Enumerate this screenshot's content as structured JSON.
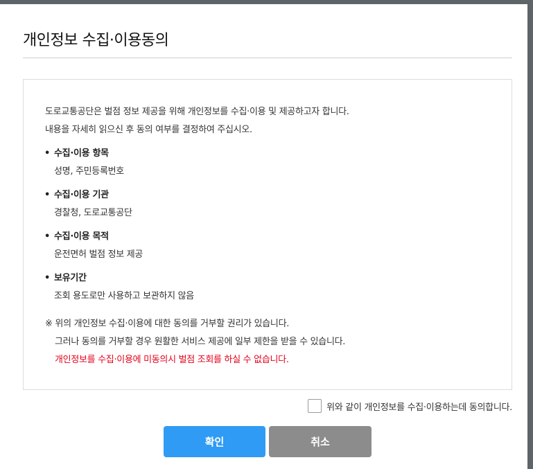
{
  "dialog": {
    "title": "개인정보 수집·이용동의",
    "intro_line1": "도로교통공단은 벌점 정보 제공을 위해 개인정보를 수집·이용 및 제공하고자 합니다.",
    "intro_line2": "내용을 자세히 읽으신 후 동의 여부를 결정하여 주십시오.",
    "bullet": "•",
    "sections": [
      {
        "heading": "수집·이용 항목",
        "body": "성명, 주민등록번호"
      },
      {
        "heading": "수집·이용 기관",
        "body": "경찰청, 도로교통공단"
      },
      {
        "heading": "수집·이용 목적",
        "body": "운전면허 벌점 정보 제공"
      },
      {
        "heading": "보유기간",
        "body": "조회 용도로만 사용하고 보관하지 않음"
      }
    ],
    "notice_line1": "※ 위의 개인정보 수집·이용에 대한 동의를 거부할 권리가 있습니다.",
    "notice_line2": "그러나 동의를 거부할 경우 원활한 서비스 제공에 일부 제한을 받을 수 있습니다.",
    "notice_warning": "개인정보를 수집·이용에 미동의시 벌점 조회를 하실 수 없습니다.",
    "agree_label": "위와 같이 개인정보를 수집·이용하는데 동의합니다.",
    "agree_checked": false,
    "confirm_label": "확인",
    "cancel_label": "취소"
  },
  "colors": {
    "confirm": "#2f9bf4",
    "cancel": "#8c8c8c",
    "warning": "#e3001b"
  }
}
